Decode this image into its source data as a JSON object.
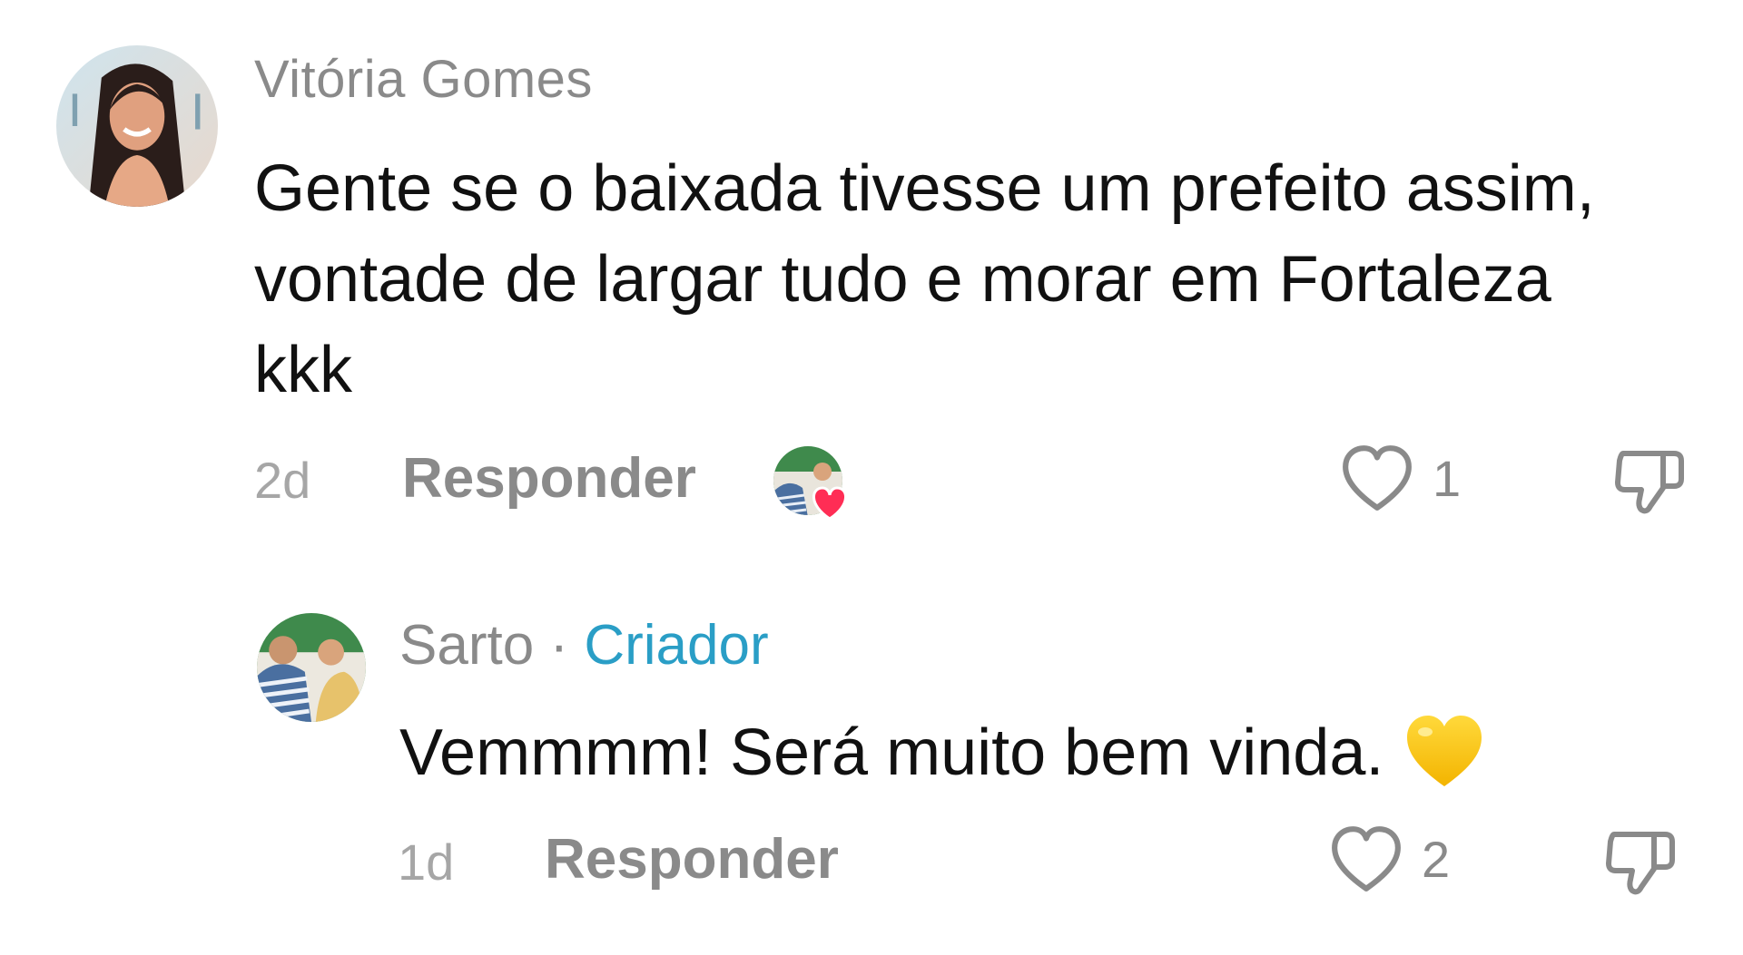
{
  "comment": {
    "author": "Vitória Gomes",
    "avatar_icon": "user-avatar-photo",
    "text": "Gente se o baixada tivesse um prefeito assim, vontade de largar tudo e morar em Fortaleza kkk",
    "time": "2d",
    "reply_label": "Responder",
    "liked_by_creator_icon": "creator-liked-heart-icon",
    "like_count": "1",
    "like_icon": "heart-outline-icon",
    "dislike_icon": "thumbs-down-outline-icon"
  },
  "reply": {
    "author": "Sarto",
    "separator": "·",
    "badge": "Criador",
    "avatar_icon": "creator-avatar-photo",
    "text": "Vemmmm! Será muito bem vinda.",
    "emoji_icon": "yellow-heart-emoji",
    "time": "1d",
    "reply_label": "Responder",
    "like_count": "2",
    "like_icon": "heart-outline-icon",
    "dislike_icon": "thumbs-down-outline-icon"
  },
  "colors": {
    "creator_badge": "#2a9ec6",
    "liked_heart": "#ff2d55",
    "emoji_yellow": "#ffcc1f",
    "muted_text": "#8a8a8a"
  }
}
